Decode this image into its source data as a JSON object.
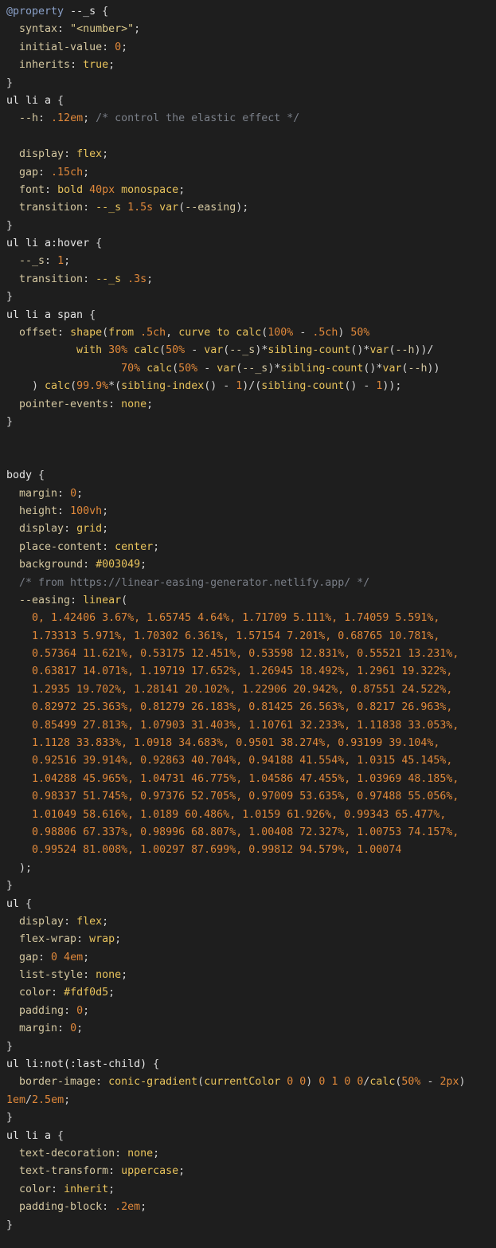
{
  "editor": {
    "language": "CSS",
    "lines": [
      [
        [
          "at",
          "@property"
        ],
        [
          "sel",
          " --_s "
        ],
        [
          "punc",
          "{"
        ]
      ],
      [
        [
          "prop",
          "  syntax"
        ],
        [
          "punc",
          ": "
        ],
        [
          "str",
          "\"<number>\""
        ],
        [
          "punc",
          ";"
        ]
      ],
      [
        [
          "prop",
          "  initial-value"
        ],
        [
          "punc",
          ": "
        ],
        [
          "num",
          "0"
        ],
        [
          "punc",
          ";"
        ]
      ],
      [
        [
          "prop",
          "  inherits"
        ],
        [
          "punc",
          ": "
        ],
        [
          "val",
          "true"
        ],
        [
          "punc",
          ";"
        ]
      ],
      [
        [
          "punc",
          "}"
        ]
      ],
      [
        [
          "sel",
          "ul li a "
        ],
        [
          "punc",
          "{"
        ]
      ],
      [
        [
          "prop",
          "  --h"
        ],
        [
          "punc",
          ": "
        ],
        [
          "num",
          ".12em"
        ],
        [
          "punc",
          "; "
        ],
        [
          "cmt",
          "/* control the elastic effect */"
        ]
      ],
      [
        [
          "sel",
          ""
        ]
      ],
      [
        [
          "prop",
          "  display"
        ],
        [
          "punc",
          ": "
        ],
        [
          "val",
          "flex"
        ],
        [
          "punc",
          ";"
        ]
      ],
      [
        [
          "prop",
          "  gap"
        ],
        [
          "punc",
          ": "
        ],
        [
          "num",
          ".15ch"
        ],
        [
          "punc",
          ";"
        ]
      ],
      [
        [
          "prop",
          "  font"
        ],
        [
          "punc",
          ": "
        ],
        [
          "val",
          "bold "
        ],
        [
          "num",
          "40px"
        ],
        [
          "val",
          " monospace"
        ],
        [
          "punc",
          ";"
        ]
      ],
      [
        [
          "prop",
          "  transition"
        ],
        [
          "punc",
          ": "
        ],
        [
          "val",
          "--_s "
        ],
        [
          "num",
          "1.5s"
        ],
        [
          "val",
          " var"
        ],
        [
          "punc",
          "("
        ],
        [
          "prop",
          "--easing"
        ],
        [
          "punc",
          ");"
        ]
      ],
      [
        [
          "punc",
          "}"
        ]
      ],
      [
        [
          "sel",
          "ul li a:hover "
        ],
        [
          "punc",
          "{"
        ]
      ],
      [
        [
          "prop",
          "  --_s"
        ],
        [
          "punc",
          ": "
        ],
        [
          "num",
          "1"
        ],
        [
          "punc",
          ";"
        ]
      ],
      [
        [
          "prop",
          "  transition"
        ],
        [
          "punc",
          ": "
        ],
        [
          "val",
          "--_s "
        ],
        [
          "num",
          ".3s"
        ],
        [
          "punc",
          ";"
        ]
      ],
      [
        [
          "punc",
          "}"
        ]
      ],
      [
        [
          "sel",
          "ul li a span "
        ],
        [
          "punc",
          "{"
        ]
      ],
      [
        [
          "prop",
          "  offset"
        ],
        [
          "punc",
          ": "
        ],
        [
          "val",
          "shape"
        ],
        [
          "punc",
          "("
        ],
        [
          "val",
          "from "
        ],
        [
          "num",
          ".5ch"
        ],
        [
          "punc",
          ", "
        ],
        [
          "val",
          "curve to calc"
        ],
        [
          "punc",
          "("
        ],
        [
          "num",
          "100%"
        ],
        [
          "punc",
          " - "
        ],
        [
          "num",
          ".5ch"
        ],
        [
          "punc",
          ") "
        ],
        [
          "num",
          "50%"
        ]
      ],
      [
        [
          "val",
          "           with "
        ],
        [
          "num",
          "30%"
        ],
        [
          "val",
          " calc"
        ],
        [
          "punc",
          "("
        ],
        [
          "num",
          "50%"
        ],
        [
          "punc",
          " - "
        ],
        [
          "val",
          "var"
        ],
        [
          "punc",
          "("
        ],
        [
          "prop",
          "--_s"
        ],
        [
          "punc",
          ")*"
        ],
        [
          "val",
          "sibling-count"
        ],
        [
          "punc",
          "()*"
        ],
        [
          "val",
          "var"
        ],
        [
          "punc",
          "("
        ],
        [
          "prop",
          "--h"
        ],
        [
          "punc",
          "))/"
        ]
      ],
      [
        [
          "num",
          "                  70%"
        ],
        [
          "val",
          " calc"
        ],
        [
          "punc",
          "("
        ],
        [
          "num",
          "50%"
        ],
        [
          "punc",
          " - "
        ],
        [
          "val",
          "var"
        ],
        [
          "punc",
          "("
        ],
        [
          "prop",
          "--_s"
        ],
        [
          "punc",
          ")*"
        ],
        [
          "val",
          "sibling-count"
        ],
        [
          "punc",
          "()*"
        ],
        [
          "val",
          "var"
        ],
        [
          "punc",
          "("
        ],
        [
          "prop",
          "--h"
        ],
        [
          "punc",
          "))"
        ]
      ],
      [
        [
          "punc",
          "    ) "
        ],
        [
          "val",
          "calc"
        ],
        [
          "punc",
          "("
        ],
        [
          "num",
          "99.9%"
        ],
        [
          "punc",
          "*("
        ],
        [
          "val",
          "sibling-index"
        ],
        [
          "punc",
          "() - "
        ],
        [
          "num",
          "1"
        ],
        [
          "punc",
          ")/("
        ],
        [
          "val",
          "sibling-count"
        ],
        [
          "punc",
          "() - "
        ],
        [
          "num",
          "1"
        ],
        [
          "punc",
          "));"
        ]
      ],
      [
        [
          "prop",
          "  pointer-events"
        ],
        [
          "punc",
          ": "
        ],
        [
          "val",
          "none"
        ],
        [
          "punc",
          ";"
        ]
      ],
      [
        [
          "punc",
          "}"
        ]
      ],
      [
        [
          "sel",
          ""
        ]
      ],
      [
        [
          "sel",
          ""
        ]
      ],
      [
        [
          "sel",
          "body "
        ],
        [
          "punc",
          "{"
        ]
      ],
      [
        [
          "prop",
          "  margin"
        ],
        [
          "punc",
          ": "
        ],
        [
          "num",
          "0"
        ],
        [
          "punc",
          ";"
        ]
      ],
      [
        [
          "prop",
          "  height"
        ],
        [
          "punc",
          ": "
        ],
        [
          "num",
          "100vh"
        ],
        [
          "punc",
          ";"
        ]
      ],
      [
        [
          "prop",
          "  display"
        ],
        [
          "punc",
          ": "
        ],
        [
          "val",
          "grid"
        ],
        [
          "punc",
          ";"
        ]
      ],
      [
        [
          "prop",
          "  place-content"
        ],
        [
          "punc",
          ": "
        ],
        [
          "val",
          "center"
        ],
        [
          "punc",
          ";"
        ]
      ],
      [
        [
          "prop",
          "  background"
        ],
        [
          "punc",
          ": "
        ],
        [
          "val",
          "#003049"
        ],
        [
          "punc",
          ";"
        ]
      ],
      [
        [
          "cmt",
          "  /* from https://linear-easing-generator.netlify.app/ */"
        ]
      ],
      [
        [
          "prop",
          "  --easing"
        ],
        [
          "punc",
          ": "
        ],
        [
          "val",
          "linear"
        ],
        [
          "punc",
          "("
        ]
      ],
      [
        [
          "num",
          "    0, 1.42406 3.67%, 1.65745 4.64%, 1.71709 5.111%, 1.74059 5.591%,"
        ]
      ],
      [
        [
          "num",
          "    1.73313 5.971%, 1.70302 6.361%, 1.57154 7.201%, 0.68765 10.781%,"
        ]
      ],
      [
        [
          "num",
          "    0.57364 11.621%, 0.53175 12.451%, 0.53598 12.831%, 0.55521 13.231%,"
        ]
      ],
      [
        [
          "num",
          "    0.63817 14.071%, 1.19719 17.652%, 1.26945 18.492%, 1.2961 19.322%,"
        ]
      ],
      [
        [
          "num",
          "    1.2935 19.702%, 1.28141 20.102%, 1.22906 20.942%, 0.87551 24.522%,"
        ]
      ],
      [
        [
          "num",
          "    0.82972 25.363%, 0.81279 26.183%, 0.81425 26.563%, 0.8217 26.963%,"
        ]
      ],
      [
        [
          "num",
          "    0.85499 27.813%, 1.07903 31.403%, 1.10761 32.233%, 1.11838 33.053%,"
        ]
      ],
      [
        [
          "num",
          "    1.1128 33.833%, 1.0918 34.683%, 0.9501 38.274%, 0.93199 39.104%,"
        ]
      ],
      [
        [
          "num",
          "    0.92516 39.914%, 0.92863 40.704%, 0.94188 41.554%, 1.0315 45.145%,"
        ]
      ],
      [
        [
          "num",
          "    1.04288 45.965%, 1.04731 46.775%, 1.04586 47.455%, 1.03969 48.185%,"
        ]
      ],
      [
        [
          "num",
          "    0.98337 51.745%, 0.97376 52.705%, 0.97009 53.635%, 0.97488 55.056%,"
        ]
      ],
      [
        [
          "num",
          "    1.01049 58.616%, 1.0189 60.486%, 1.0159 61.926%, 0.99343 65.477%,"
        ]
      ],
      [
        [
          "num",
          "    0.98806 67.337%, 0.98996 68.807%, 1.00408 72.327%, 1.00753 74.157%,"
        ]
      ],
      [
        [
          "num",
          "    0.99524 81.008%, 1.00297 87.699%, 0.99812 94.579%, 1.00074"
        ]
      ],
      [
        [
          "punc",
          "  );"
        ]
      ],
      [
        [
          "punc",
          "}"
        ]
      ],
      [
        [
          "sel",
          "ul "
        ],
        [
          "punc",
          "{"
        ]
      ],
      [
        [
          "prop",
          "  display"
        ],
        [
          "punc",
          ": "
        ],
        [
          "val",
          "flex"
        ],
        [
          "punc",
          ";"
        ]
      ],
      [
        [
          "prop",
          "  flex-wrap"
        ],
        [
          "punc",
          ": "
        ],
        [
          "val",
          "wrap"
        ],
        [
          "punc",
          ";"
        ]
      ],
      [
        [
          "prop",
          "  gap"
        ],
        [
          "punc",
          ": "
        ],
        [
          "num",
          "0 4em"
        ],
        [
          "punc",
          ";"
        ]
      ],
      [
        [
          "prop",
          "  list-style"
        ],
        [
          "punc",
          ": "
        ],
        [
          "val",
          "none"
        ],
        [
          "punc",
          ";"
        ]
      ],
      [
        [
          "prop",
          "  color"
        ],
        [
          "punc",
          ": "
        ],
        [
          "val",
          "#fdf0d5"
        ],
        [
          "punc",
          ";"
        ]
      ],
      [
        [
          "prop",
          "  padding"
        ],
        [
          "punc",
          ": "
        ],
        [
          "num",
          "0"
        ],
        [
          "punc",
          ";"
        ]
      ],
      [
        [
          "prop",
          "  margin"
        ],
        [
          "punc",
          ": "
        ],
        [
          "num",
          "0"
        ],
        [
          "punc",
          ";"
        ]
      ],
      [
        [
          "punc",
          "}"
        ]
      ],
      [
        [
          "sel",
          "ul li:not(:last-child) "
        ],
        [
          "punc",
          "{"
        ]
      ],
      [
        [
          "prop",
          "  border-image"
        ],
        [
          "punc",
          ": "
        ],
        [
          "val",
          "conic-gradient"
        ],
        [
          "punc",
          "("
        ],
        [
          "val",
          "currentColor "
        ],
        [
          "num",
          "0 0"
        ],
        [
          "punc",
          ") "
        ],
        [
          "num",
          "0 1 0 0"
        ],
        [
          "punc",
          "/"
        ],
        [
          "val",
          "calc"
        ],
        [
          "punc",
          "("
        ],
        [
          "num",
          "50%"
        ],
        [
          "punc",
          " - "
        ],
        [
          "num",
          "2px"
        ],
        [
          "punc",
          ")"
        ]
      ],
      [
        [
          "num",
          "1em"
        ],
        [
          "punc",
          "/"
        ],
        [
          "num",
          "2.5em"
        ],
        [
          "punc",
          ";"
        ]
      ],
      [
        [
          "punc",
          "}"
        ]
      ],
      [
        [
          "sel",
          "ul li a "
        ],
        [
          "punc",
          "{"
        ]
      ],
      [
        [
          "prop",
          "  text-decoration"
        ],
        [
          "punc",
          ": "
        ],
        [
          "val",
          "none"
        ],
        [
          "punc",
          ";"
        ]
      ],
      [
        [
          "prop",
          "  text-transform"
        ],
        [
          "punc",
          ": "
        ],
        [
          "val",
          "uppercase"
        ],
        [
          "punc",
          ";"
        ]
      ],
      [
        [
          "prop",
          "  color"
        ],
        [
          "punc",
          ": "
        ],
        [
          "val",
          "inherit"
        ],
        [
          "punc",
          ";"
        ]
      ],
      [
        [
          "prop",
          "  padding-block"
        ],
        [
          "punc",
          ": "
        ],
        [
          "num",
          ".2em"
        ],
        [
          "punc",
          ";"
        ]
      ],
      [
        [
          "punc",
          "}"
        ]
      ]
    ]
  }
}
